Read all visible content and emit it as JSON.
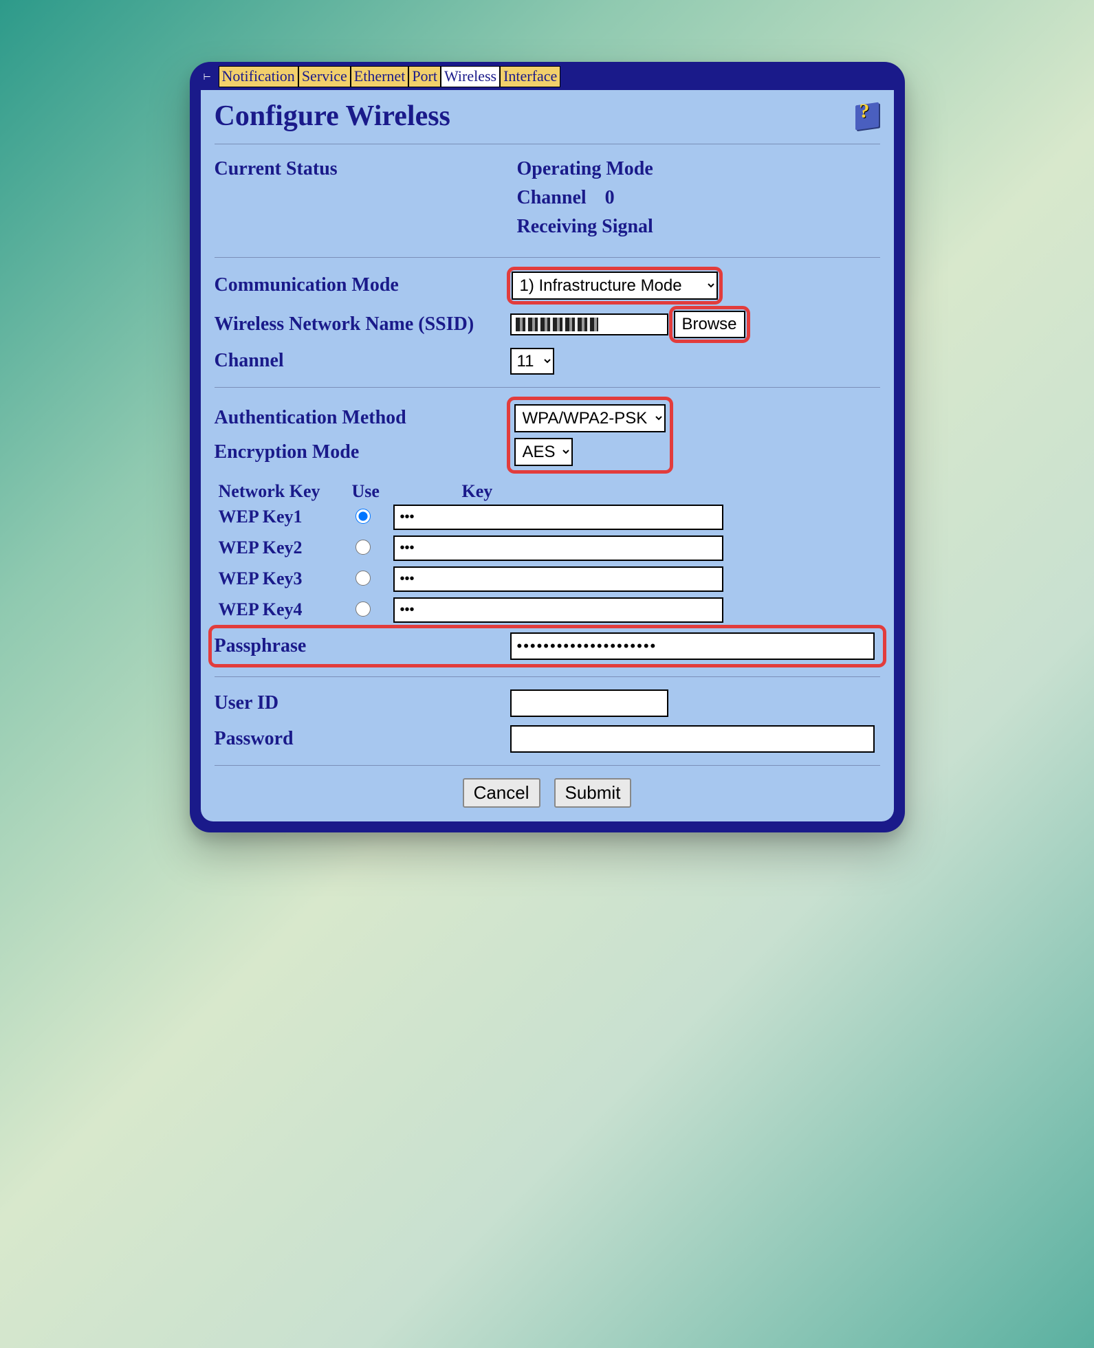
{
  "tabs": {
    "items": [
      {
        "label": "Notification"
      },
      {
        "label": "Service"
      },
      {
        "label": "Ethernet"
      },
      {
        "label": "Port"
      },
      {
        "label": "Wireless"
      },
      {
        "label": "Interface"
      }
    ],
    "active_index": 4
  },
  "page_title": "Configure Wireless",
  "status": {
    "heading": "Current Status",
    "operating_mode_label": "Operating Mode",
    "channel_label": "Channel",
    "channel_value": "0",
    "receiving_label": "Receiving Signal"
  },
  "comm_mode": {
    "label": "Communication Mode",
    "value": "1) Infrastructure Mode"
  },
  "ssid": {
    "label": "Wireless Network Name (SSID)",
    "value": "",
    "browse": "Browse"
  },
  "channel": {
    "label": "Channel",
    "value": "11"
  },
  "auth": {
    "label": "Authentication Method",
    "value": "WPA/WPA2-PSK"
  },
  "enc": {
    "label": "Encryption Mode",
    "value": "AES"
  },
  "wep_table": {
    "head_key": "Network Key",
    "head_use": "Use",
    "head_val": "Key",
    "rows": [
      {
        "label": "WEP Key1",
        "selected": true,
        "value": "•••"
      },
      {
        "label": "WEP Key2",
        "selected": false,
        "value": "•••"
      },
      {
        "label": "WEP Key3",
        "selected": false,
        "value": "•••"
      },
      {
        "label": "WEP Key4",
        "selected": false,
        "value": "•••"
      }
    ]
  },
  "passphrase": {
    "label": "Passphrase",
    "value": "•••••••••••••••••••••"
  },
  "userid": {
    "label": "User ID",
    "value": ""
  },
  "password": {
    "label": "Password",
    "value": ""
  },
  "buttons": {
    "cancel": "Cancel",
    "submit": "Submit"
  }
}
